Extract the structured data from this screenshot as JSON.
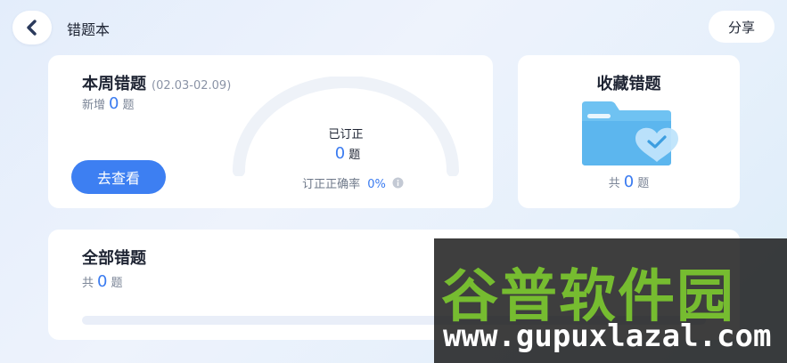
{
  "header": {
    "title": "错题本",
    "share_label": "分享"
  },
  "week_card": {
    "title": "本周错题",
    "date_range": "(02.03-02.09)",
    "new_prefix": "新增",
    "new_count": "0",
    "unit": "题",
    "go_label": "去查看",
    "corrected_label": "已订正",
    "corrected_count": "0",
    "accuracy_label": "订正正确率",
    "accuracy_value": "0%"
  },
  "fav_card": {
    "title": "收藏错题",
    "total_prefix": "共",
    "total_count": "0",
    "unit": "题"
  },
  "all_card": {
    "title": "全部错题",
    "total_prefix": "共",
    "total_count": "0",
    "unit": "题"
  },
  "watermark": {
    "cn": "谷普软件园",
    "en": "www.gupuxlazal.com"
  },
  "colors": {
    "accent": "#3d7ff2",
    "number": "#3a7bf0",
    "watermark_green": "#76bc30"
  }
}
